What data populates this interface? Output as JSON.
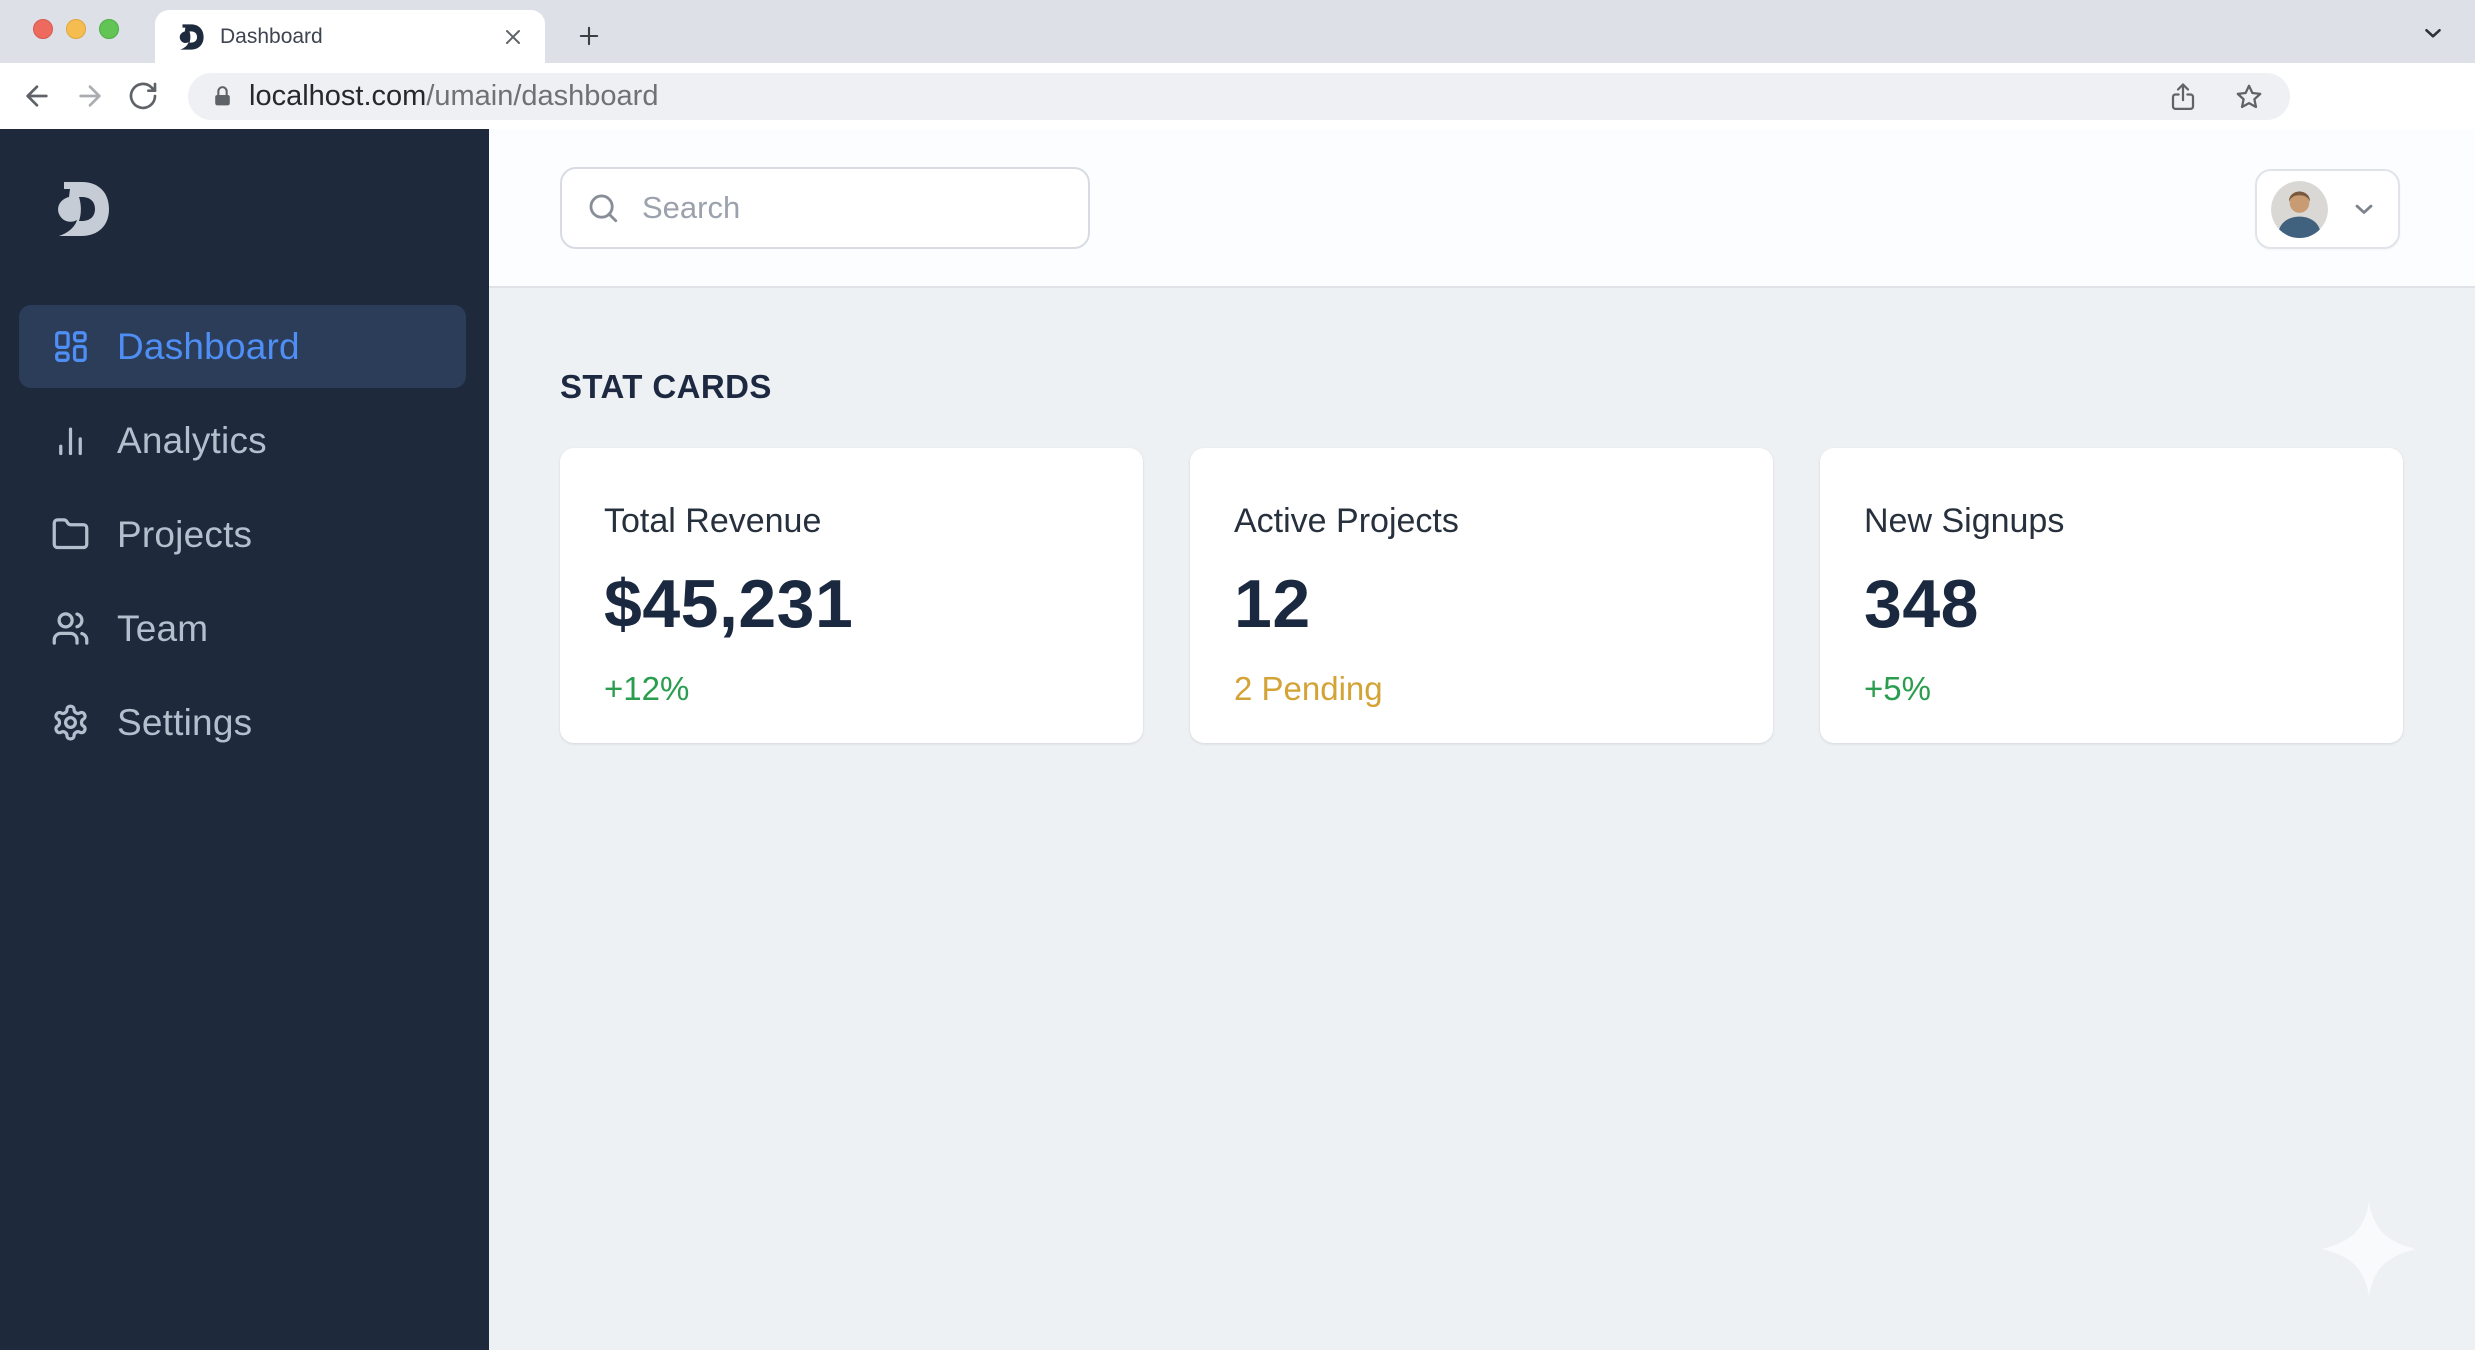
{
  "browser": {
    "traffic_lights": [
      "close",
      "minimize",
      "zoom"
    ],
    "tab": {
      "title": "Dashboard",
      "favicon": "app-logo-d",
      "close": "close-icon",
      "new_tab": "plus-icon"
    },
    "toolbar": {
      "buttons": [
        "back-icon",
        "forward-icon",
        "reload-icon",
        "share-icon",
        "bookmark-star-icon",
        "side-panel-icon",
        "profile-avatar",
        "kebab-menu-icon"
      ],
      "url": {
        "host": "localhost.com",
        "path": "/umain/dashboard",
        "security": "lock-icon"
      }
    }
  },
  "sidebar": {
    "logo": "D",
    "items": [
      {
        "label": "Dashboard",
        "icon": "dashboard-grid-icon",
        "active": true
      },
      {
        "label": "Analytics",
        "icon": "bar-chart-icon",
        "active": false
      },
      {
        "label": "Projects",
        "icon": "folder-icon",
        "active": false
      },
      {
        "label": "Team",
        "icon": "users-icon",
        "active": false
      },
      {
        "label": "Settings",
        "icon": "gear-icon",
        "active": false
      }
    ]
  },
  "header": {
    "search": {
      "placeholder": "Search",
      "value": "",
      "icon": "search-icon"
    },
    "user_menu": {
      "avatar": "user-photo",
      "icon": "chevron-down-icon"
    }
  },
  "main": {
    "section_title": "STAT CARDS",
    "cards": [
      {
        "title": "Total Revenue",
        "value": "$45,231",
        "delta": "+12%",
        "delta_color": "#2a9d4e"
      },
      {
        "title": "Active Projects",
        "value": "12",
        "delta": "2 Pending",
        "delta_color": "#d3a336"
      },
      {
        "title": "New Signups",
        "value": "348",
        "delta": "+5%",
        "delta_color": "#2a9d4e"
      }
    ],
    "decoration": "sparkle-icon"
  },
  "colors": {
    "sidebar_bg": "#1e2a3c",
    "active_item_bg": "#2b3d58",
    "accent_blue": "#4e8ef5",
    "positive_green": "#2a9d4e",
    "pending_amber": "#d3a336",
    "content_bg": "#eef1f4",
    "value_text": "#1b2940"
  }
}
